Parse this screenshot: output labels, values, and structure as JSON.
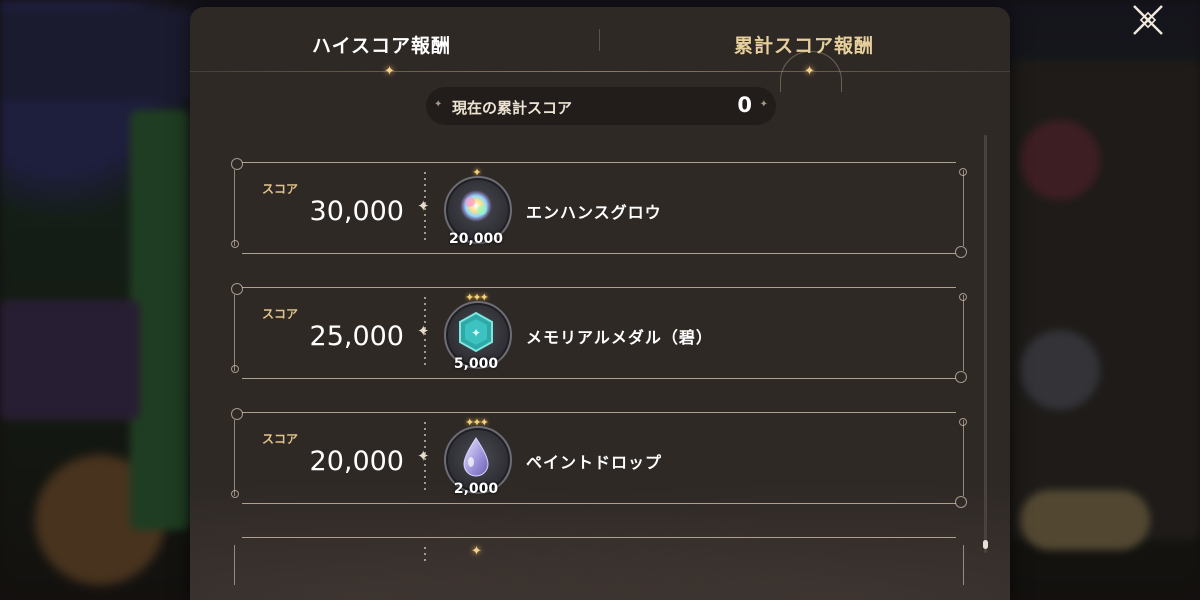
{
  "tabs": {
    "high_score": "ハイスコア報酬",
    "total_score": "累計スコア報酬"
  },
  "total": {
    "label": "現在の累計スコア",
    "value": "0"
  },
  "rewards": [
    {
      "score_label": "スコア",
      "score": "30,000",
      "item_name": "エンハンスグロウ",
      "count": "20,000",
      "stars": "✦"
    },
    {
      "score_label": "スコア",
      "score": "25,000",
      "item_name": "メモリアルメダル（碧）",
      "count": "5,000",
      "stars": "✦✦✦"
    },
    {
      "score_label": "スコア",
      "score": "20,000",
      "item_name": "ペイントドロップ",
      "count": "2,000",
      "stars": "✦✦✦"
    }
  ],
  "icons": {
    "close": "close-icon",
    "item1": "enhance-glow-icon",
    "item2": "memorial-medal-icon",
    "item3": "paint-drop-icon"
  },
  "colors": {
    "panel": "#2f2926",
    "accent_gold": "#e0c487",
    "active_tab": "#e6cf9c"
  }
}
